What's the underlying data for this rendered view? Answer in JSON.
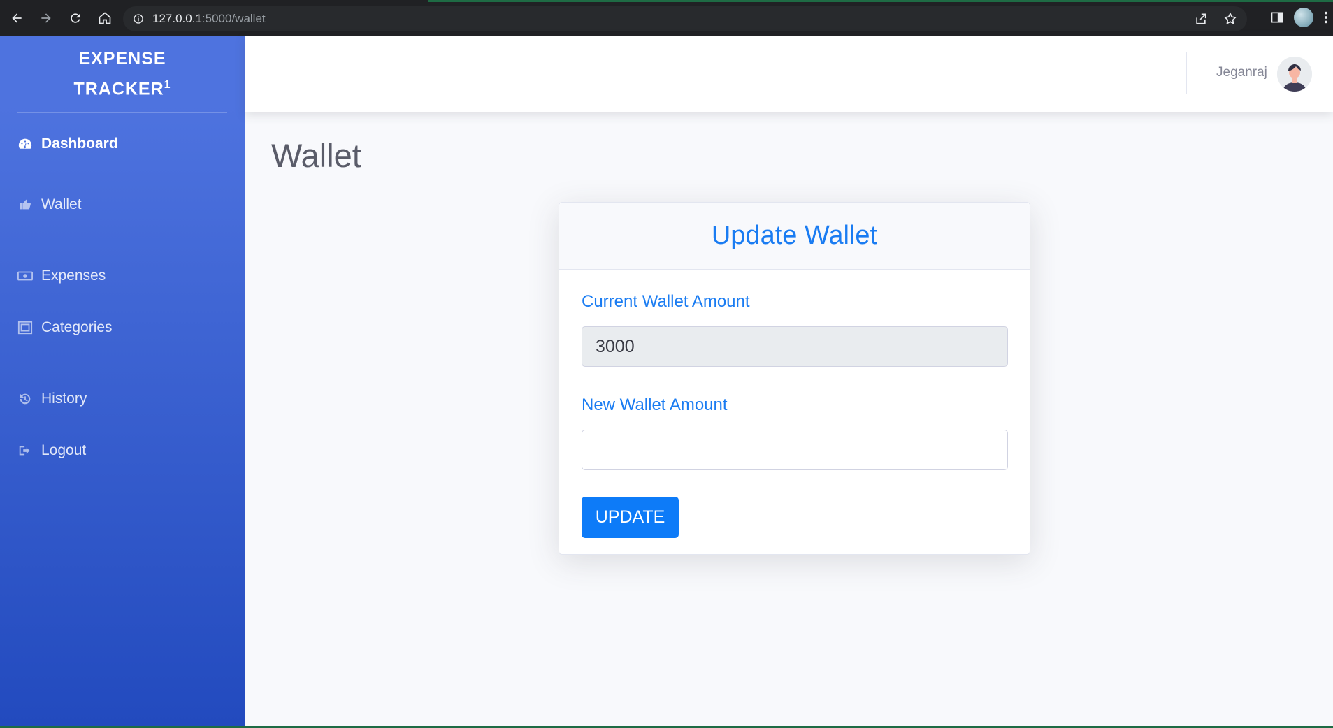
{
  "browser": {
    "url_host": "127.0.0.1",
    "url_path": ":5000/wallet"
  },
  "sidebar": {
    "brand_line1": "EXPENSE",
    "brand_line2": "TRACKER",
    "brand_sup": "1",
    "items": [
      {
        "label": "Dashboard",
        "icon": "tachometer-icon"
      },
      {
        "label": "Wallet",
        "icon": "wallet-icon"
      },
      {
        "label": "Expenses",
        "icon": "money-bill-icon"
      },
      {
        "label": "Categories",
        "icon": "grid-icon"
      },
      {
        "label": "History",
        "icon": "history-icon"
      },
      {
        "label": "Logout",
        "icon": "sign-out-icon"
      }
    ]
  },
  "topbar": {
    "username": "Jeganraj"
  },
  "main": {
    "page_title": "Wallet",
    "card": {
      "title": "Update Wallet",
      "current_label": "Current Wallet Amount",
      "current_value": "3000",
      "new_label": "New Wallet Amount",
      "new_value": "",
      "button_label": "UPDATE"
    }
  },
  "colors": {
    "sidebar_top": "#4e73df",
    "sidebar_bottom": "#224abe",
    "accent": "#1a7cf2",
    "button": "#0d7bf8"
  }
}
